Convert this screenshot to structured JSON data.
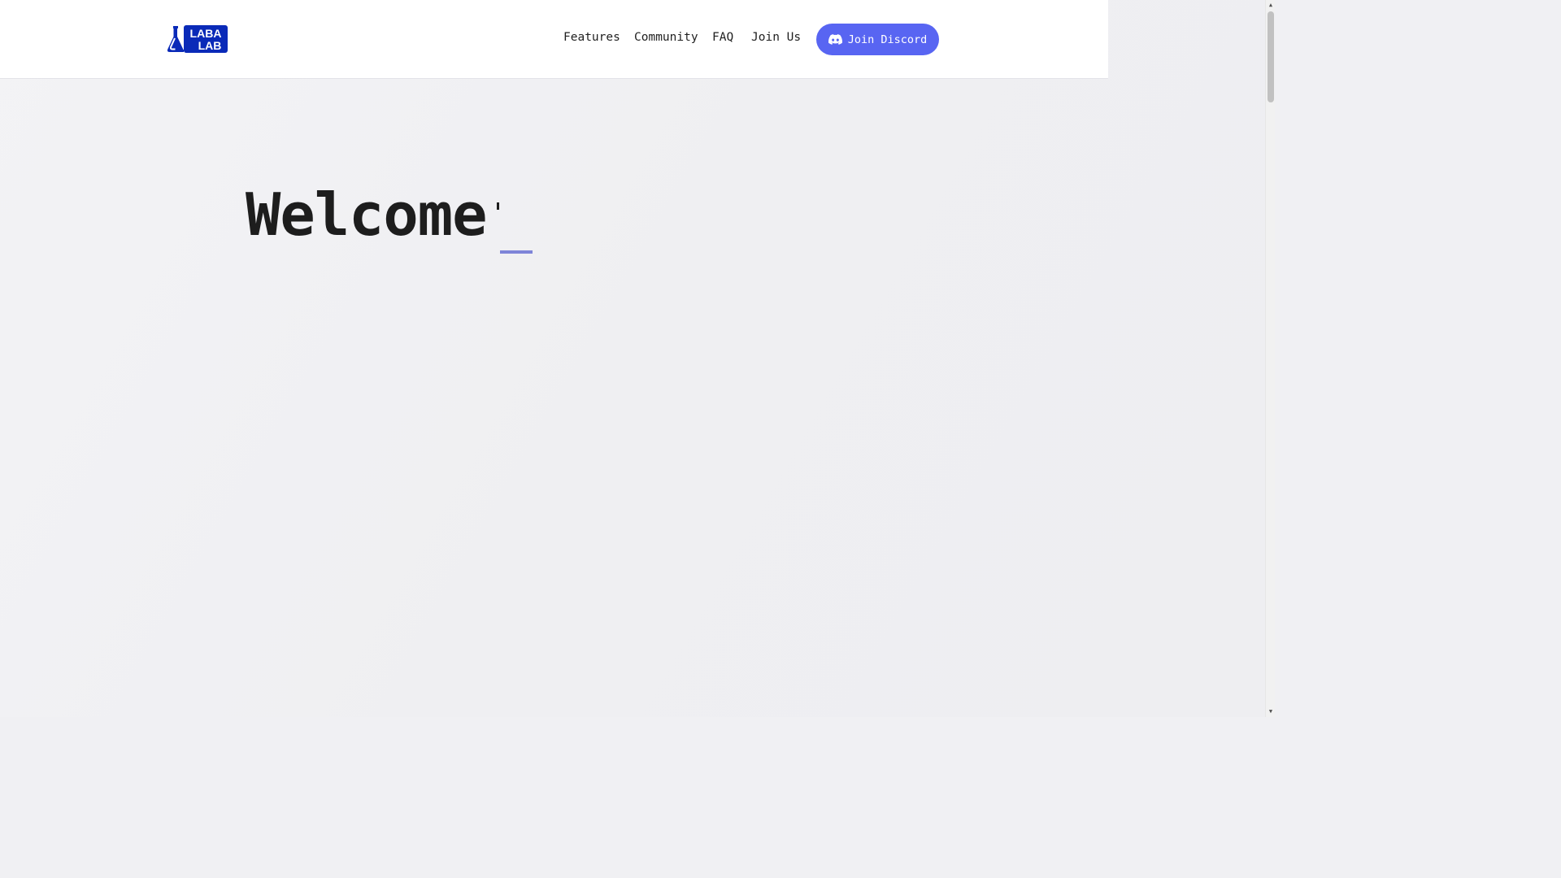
{
  "brand": {
    "logo_text_line1": "LABA",
    "logo_text_line2": "LAB",
    "logo_icon": "flask-icon",
    "color": "#0a2ab8"
  },
  "nav": {
    "links": [
      {
        "label": "Features"
      },
      {
        "label": "Community"
      },
      {
        "label": "FAQ"
      },
      {
        "label": "Join Us"
      }
    ],
    "cta": {
      "label": "Join Discord",
      "icon": "discord-icon",
      "color": "#5865f2"
    }
  },
  "hero": {
    "title": "Welcome",
    "cursor_color": "#7e84d8"
  },
  "scrollbar": {
    "up_icon": "▲",
    "down_icon": "▼"
  }
}
